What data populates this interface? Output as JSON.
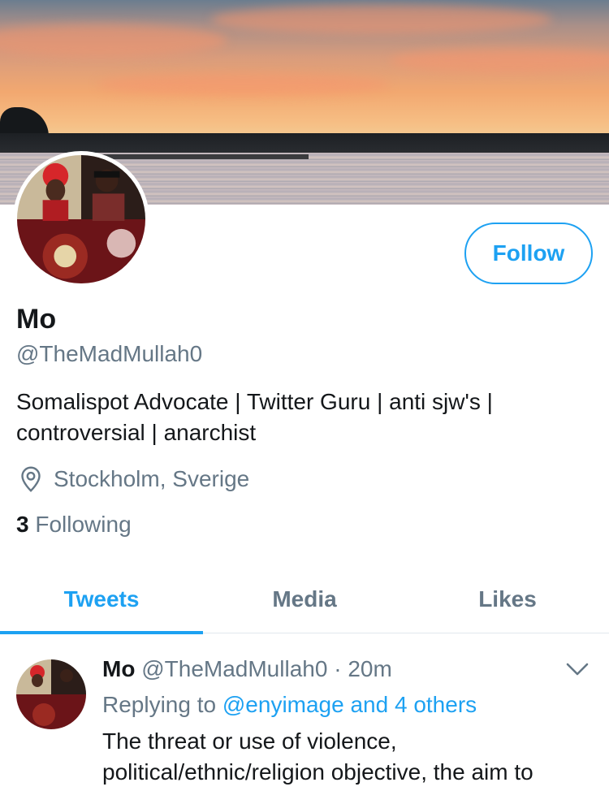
{
  "profile": {
    "display_name": "Mo",
    "handle": "@TheMadMullah0",
    "bio_line1": "Somalispot Advocate | Twitter Guru | anti sjw's |",
    "bio_line2": "controversial | anarchist",
    "location": "Stockholm, Sverige",
    "following_count": "3",
    "following_label": "Following",
    "follow_button": "Follow",
    "avatar_icon": "profile-photo",
    "location_icon": "location-pin-icon"
  },
  "tabs": [
    {
      "label": "Tweets",
      "active": true
    },
    {
      "label": "Media",
      "active": false
    },
    {
      "label": "Likes",
      "active": false
    }
  ],
  "tweet": {
    "name": "Mo",
    "handle": "@TheMadMullah0",
    "separator": "·",
    "time": "20m",
    "replying_prefix": "Replying to",
    "replying_to": "@enyimage and 4 others",
    "text": "The threat or use of violence, political/ethnic/religion objective, the aim to"
  },
  "colors": {
    "accent": "#1da1f2",
    "muted": "#657786",
    "text": "#14171a"
  }
}
